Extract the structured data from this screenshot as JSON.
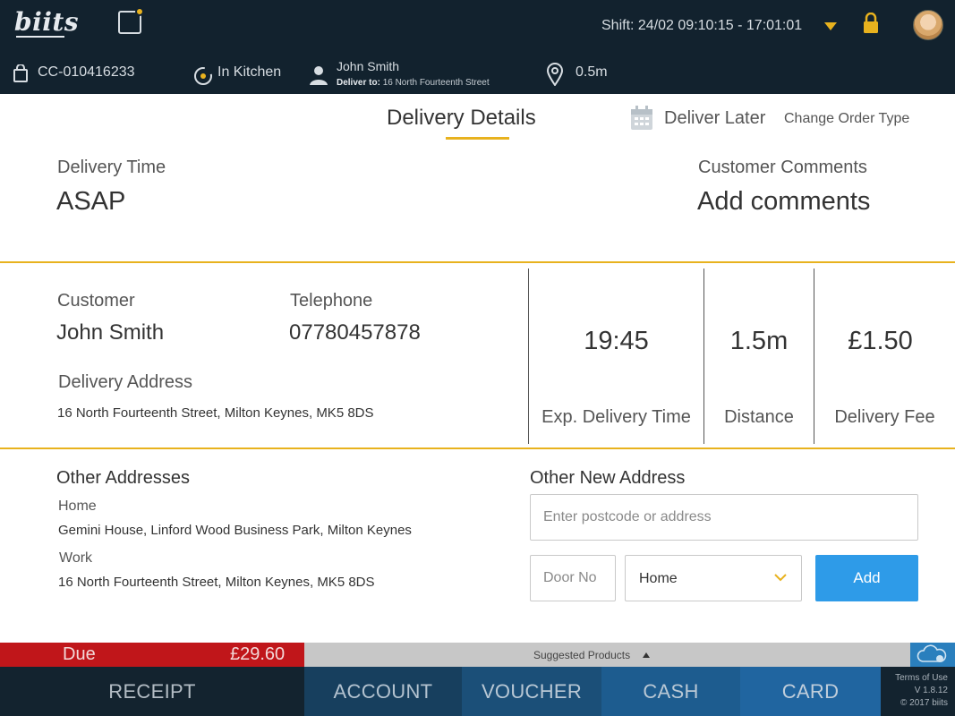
{
  "app": {
    "logo": "biits",
    "shift": "Shift: 24/02  09:10:15 - 17:01:01"
  },
  "order": {
    "id": "CC-010416233",
    "status": "In Kitchen",
    "customer_name": "John Smith",
    "deliver_to_label": "Deliver to:",
    "deliver_to_address": "16 North Fourteenth Street",
    "distance": "0.5m"
  },
  "tabs": {
    "delivery_details": "Delivery Details",
    "deliver_later": "Deliver Later",
    "change_order_type": "Change Order Type"
  },
  "delivery": {
    "time_label": "Delivery Time",
    "time_value": "ASAP",
    "comments_label": "Customer Comments",
    "comments_value": "Add comments"
  },
  "customer": {
    "customer_label": "Customer",
    "customer_value": "John Smith",
    "telephone_label": "Telephone",
    "telephone_value": "07780457878",
    "address_label": "Delivery Address",
    "address_value": "16 North Fourteenth Street, Milton Keynes, MK5 8DS"
  },
  "stats": {
    "exp_time_value": "19:45",
    "exp_time_label": "Exp. Delivery Time",
    "distance_value": "1.5m",
    "distance_label": "Distance",
    "fee_value": "£1.50",
    "fee_label": "Delivery Fee"
  },
  "other_addresses": {
    "title": "Other Addresses",
    "items": [
      {
        "type": "Home",
        "address": "Gemini House, Linford Wood Business Park, Milton Keynes"
      },
      {
        "type": "Work",
        "address": "16 North Fourteenth Street, Milton Keynes, MK5 8DS"
      }
    ]
  },
  "new_address": {
    "title": "Other New Address",
    "search_placeholder": "Enter postcode or address",
    "door_placeholder": "Door No",
    "type_selected": "Home",
    "add_label": "Add"
  },
  "footer": {
    "due_label": "Due",
    "due_amount": "£29.60",
    "suggested_label": "Suggested Products",
    "receipt": "RECEIPT",
    "account": "ACCOUNT",
    "voucher": "VOUCHER",
    "cash": "CASH",
    "card": "CARD",
    "terms": "Terms of Use",
    "version": "V 1.8.12",
    "copyright": "© 2017 biits"
  },
  "colors": {
    "accent": "#e8b21e",
    "header_bg": "#12222e",
    "due_red": "#c0161a",
    "add_blue": "#2e9be8"
  },
  "icons": [
    "bag-icon",
    "kitchen-icon",
    "user-icon",
    "location-pin-icon",
    "calendar-icon",
    "lock-icon",
    "chevron-down-icon",
    "cloud-icon",
    "notification-icon"
  ]
}
